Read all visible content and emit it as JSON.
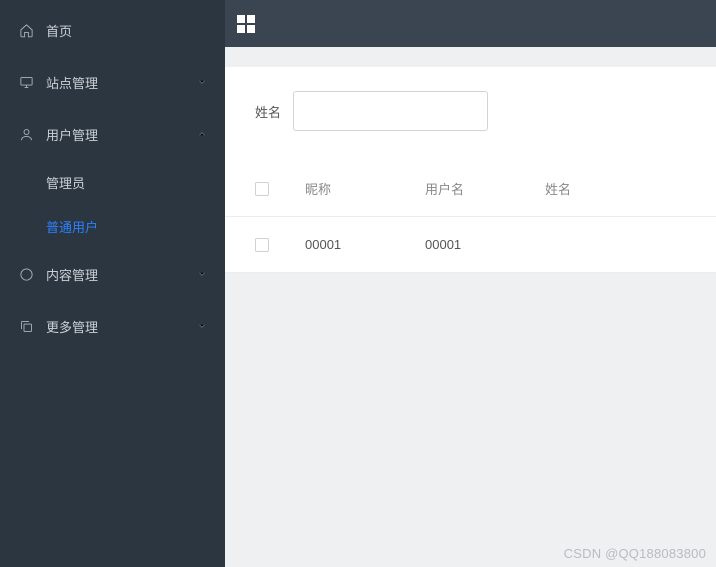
{
  "sidebar": {
    "items": [
      {
        "label": "首页",
        "icon": "home-icon",
        "expandable": false
      },
      {
        "label": "站点管理",
        "icon": "monitor-icon",
        "expandable": true,
        "expanded": false
      },
      {
        "label": "用户管理",
        "icon": "user-icon",
        "expandable": true,
        "expanded": true,
        "children": [
          {
            "label": "管理员",
            "active": false
          },
          {
            "label": "普通用户",
            "active": true
          }
        ]
      },
      {
        "label": "内容管理",
        "icon": "chat-icon",
        "expandable": true,
        "expanded": false
      },
      {
        "label": "更多管理",
        "icon": "copy-icon",
        "expandable": true,
        "expanded": false
      }
    ]
  },
  "filter": {
    "name_label": "姓名",
    "name_value": ""
  },
  "table": {
    "headers": {
      "nickname": "昵称",
      "username": "用户名",
      "realname": "姓名"
    },
    "rows": [
      {
        "nickname": "00001",
        "username": "00001",
        "realname": ""
      }
    ]
  },
  "watermark": "CSDN @QQ188083800"
}
